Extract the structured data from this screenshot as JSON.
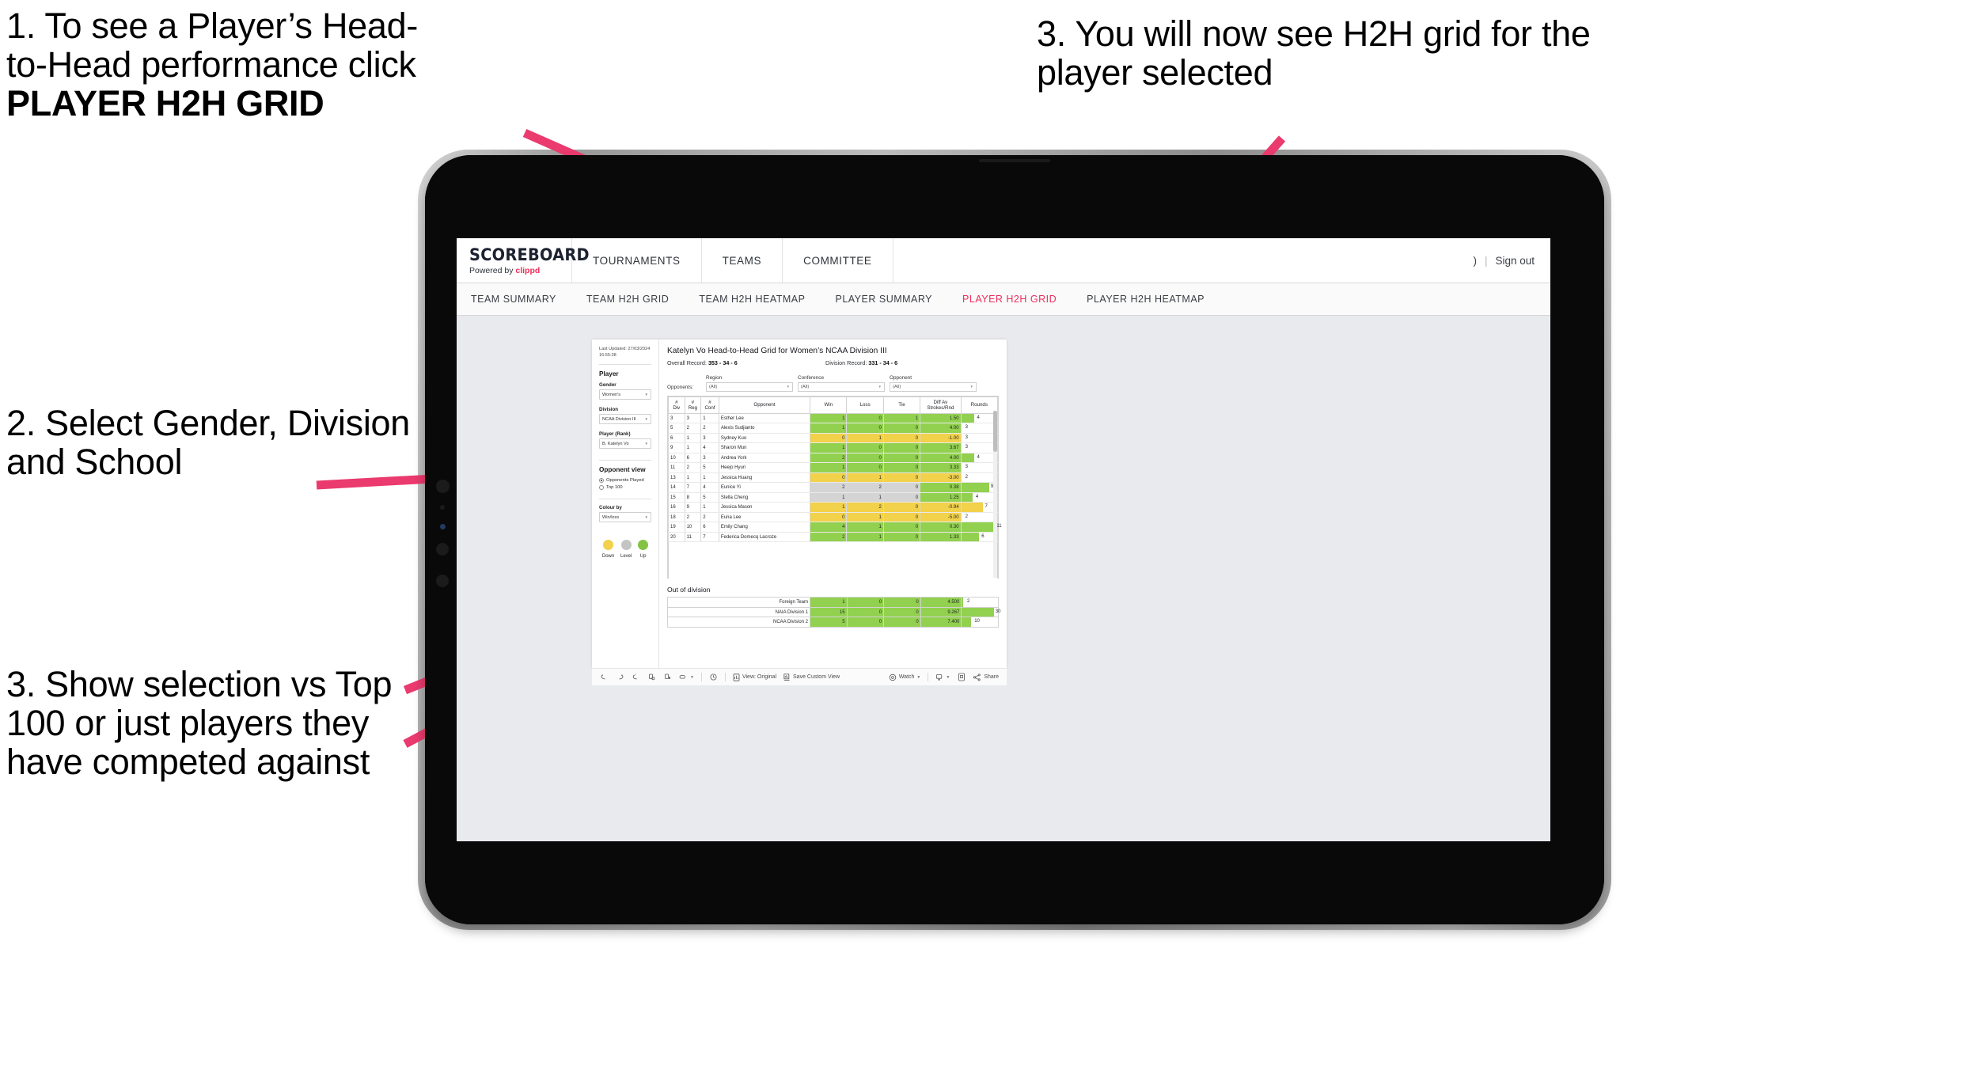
{
  "annotations": {
    "step1_line1": "1. To see a Player’s Head-",
    "step1_line2": "to-Head performance click ",
    "step1_bold": "PLAYER H2H GRID",
    "step2": "2. Select Gender, Division and School",
    "step3_left": "3. Show selection vs Top 100 or just players they have competed against",
    "step3_right": "3. You will now see H2H grid for the player selected",
    "arrow_color": "#ea3a6e"
  },
  "app": {
    "brand_name": "SCOREBOARD",
    "brand_sub_prefix": "Powered by ",
    "brand_sub_accent": "clippd",
    "accent_color": "#ed2d5a",
    "top_nav": [
      {
        "label": "TOURNAMENTS"
      },
      {
        "label": "TEAMS"
      },
      {
        "label": "COMMITTEE"
      }
    ],
    "top_right": {
      "user_glyph": ")",
      "separator": "|",
      "sign_out": "Sign out"
    },
    "sub_nav": [
      {
        "label": "TEAM SUMMARY",
        "active": false
      },
      {
        "label": "TEAM H2H GRID",
        "active": false
      },
      {
        "label": "TEAM H2H HEATMAP",
        "active": false
      },
      {
        "label": "PLAYER SUMMARY",
        "active": false
      },
      {
        "label": "PLAYER H2H GRID",
        "active": true
      },
      {
        "label": "PLAYER H2H HEATMAP",
        "active": false
      }
    ]
  },
  "viz": {
    "sidebar": {
      "last_updated_line1": "Last Updated: 27/03/2024",
      "last_updated_line2": "16:55:38",
      "player_heading": "Player",
      "gender_label": "Gender",
      "gender_value": "Women's",
      "division_label": "Division",
      "division_value": "NCAA Division III",
      "player_rank_label": "Player (Rank)",
      "player_rank_value": "B. Katelyn Vo",
      "opponent_view_heading": "Opponent view",
      "opponent_view_options": [
        {
          "label": "Opponents Played",
          "selected": true
        },
        {
          "label": "Top 100",
          "selected": false
        }
      ],
      "colour_by_label": "Colour by",
      "colour_by_value": "Win/loss",
      "legend": [
        {
          "label": "Down",
          "color": "#f2d14b"
        },
        {
          "label": "Level",
          "color": "#c4c4c4"
        },
        {
          "label": "Up",
          "color": "#82c346"
        }
      ]
    },
    "title": "Katelyn Vo Head-to-Head Grid for Women’s NCAA Division III",
    "overall_record_label": "Overall Record:",
    "overall_record_value": "353 -  34 - 6",
    "division_record_label": "Division Record:",
    "division_record_value": "331 -  34 - 6",
    "opponents_label": "Opponents:",
    "filters": [
      {
        "caption": "Region",
        "value": "(All)"
      },
      {
        "caption": "Conference",
        "value": "(All)"
      },
      {
        "caption": "Opponent",
        "value": "(All)"
      }
    ],
    "columns": [
      {
        "line1": "#",
        "line2": "Div"
      },
      {
        "line1": "#",
        "line2": "Reg"
      },
      {
        "line1": "#",
        "line2": "Conf"
      },
      {
        "line1": "Opponent",
        "line2": ""
      },
      {
        "line1": "Win",
        "line2": ""
      },
      {
        "line1": "Loss",
        "line2": ""
      },
      {
        "line1": "Tie",
        "line2": ""
      },
      {
        "line1": "Diff Av",
        "line2": "Strokes/Rnd"
      },
      {
        "line1": "Rounds",
        "line2": ""
      }
    ],
    "out_of_division_title": "Out of division"
  },
  "chart_data": {
    "type": "table",
    "title": "Katelyn Vo Head-to-Head Grid for Women’s NCAA Division III",
    "columns": [
      "# Div",
      "# Reg",
      "# Conf",
      "Opponent",
      "Win",
      "Loss",
      "Tie",
      "Diff Av Strokes/Rnd",
      "Rounds"
    ],
    "rows": [
      {
        "div": "3",
        "reg": "3",
        "conf": "1",
        "opponent": "Esther Lee",
        "win": "1",
        "loss": "0",
        "tie": "1",
        "diff": "1.50",
        "rounds": "4",
        "state": "up",
        "bar_pct": 36
      },
      {
        "div": "5",
        "reg": "2",
        "conf": "2",
        "opponent": "Alexis Sudjianto",
        "win": "1",
        "loss": "0",
        "tie": "0",
        "diff": "4.00",
        "rounds": "3",
        "state": "up",
        "bar_pct": 0
      },
      {
        "div": "6",
        "reg": "1",
        "conf": "3",
        "opponent": "Sydney Kuo",
        "win": "0",
        "loss": "1",
        "tie": "0",
        "diff": "-1.00",
        "rounds": "3",
        "state": "down",
        "bar_pct": 0
      },
      {
        "div": "9",
        "reg": "1",
        "conf": "4",
        "opponent": "Sharon Mun",
        "win": "1",
        "loss": "0",
        "tie": "0",
        "diff": "3.67",
        "rounds": "3",
        "state": "up",
        "bar_pct": 0
      },
      {
        "div": "10",
        "reg": "6",
        "conf": "3",
        "opponent": "Andrea York",
        "win": "2",
        "loss": "0",
        "tie": "0",
        "diff": "4.00",
        "rounds": "4",
        "state": "up",
        "bar_pct": 36
      },
      {
        "div": "11",
        "reg": "2",
        "conf": "5",
        "opponent": "Heejo Hyun",
        "win": "1",
        "loss": "0",
        "tie": "0",
        "diff": "3.33",
        "rounds": "3",
        "state": "up",
        "bar_pct": 0
      },
      {
        "div": "13",
        "reg": "1",
        "conf": "1",
        "opponent": "Jessica Huang",
        "win": "0",
        "loss": "1",
        "tie": "0",
        "diff": "-3.00",
        "rounds": "2",
        "state": "down",
        "bar_pct": 0
      },
      {
        "div": "14",
        "reg": "7",
        "conf": "4",
        "opponent": "Eunice Yi",
        "win": "2",
        "loss": "2",
        "tie": "0",
        "diff": "0.38",
        "rounds": "9",
        "state": "level",
        "bar_pct": 78,
        "diff_state": "up"
      },
      {
        "div": "15",
        "reg": "8",
        "conf": "5",
        "opponent": "Stella Cheng",
        "win": "1",
        "loss": "1",
        "tie": "0",
        "diff": "1.25",
        "rounds": "4",
        "state": "level",
        "bar_pct": 32,
        "diff_state": "up"
      },
      {
        "div": "16",
        "reg": "9",
        "conf": "1",
        "opponent": "Jessica Mason",
        "win": "1",
        "loss": "2",
        "tie": "0",
        "diff": "-0.94",
        "rounds": "7",
        "state": "down",
        "bar_pct": 60
      },
      {
        "div": "18",
        "reg": "2",
        "conf": "2",
        "opponent": "Euna Lee",
        "win": "0",
        "loss": "1",
        "tie": "0",
        "diff": "-5.00",
        "rounds": "2",
        "state": "down",
        "bar_pct": 0
      },
      {
        "div": "19",
        "reg": "10",
        "conf": "6",
        "opponent": "Emily Chang",
        "win": "4",
        "loss": "1",
        "tie": "0",
        "diff": "0.30",
        "rounds": "11",
        "state": "up",
        "bar_pct": 96
      },
      {
        "div": "20",
        "reg": "11",
        "conf": "7",
        "opponent": "Federica Domecq Lacroze",
        "win": "2",
        "loss": "1",
        "tie": "0",
        "diff": "1.33",
        "rounds": "6",
        "state": "up",
        "bar_pct": 50
      }
    ],
    "out_of_division": [
      {
        "name": "Foreign Team",
        "win": "1",
        "loss": "0",
        "tie": "0",
        "diff": "4.500",
        "rounds": "2",
        "state": "up",
        "bar_pct": 4
      },
      {
        "name": "NAIA Division 1",
        "win": "15",
        "loss": "0",
        "tie": "0",
        "diff": "9.267",
        "rounds": "30",
        "state": "up",
        "bar_pct": 90
      },
      {
        "name": "NCAA Division 2",
        "win": "5",
        "loss": "0",
        "tie": "0",
        "diff": "7.400",
        "rounds": "10",
        "state": "up",
        "bar_pct": 26
      }
    ],
    "legend": [
      {
        "label": "Down",
        "color": "#f2d14b"
      },
      {
        "label": "Level",
        "color": "#c4c4c4"
      },
      {
        "label": "Up",
        "color": "#82c346"
      }
    ]
  },
  "toolbar": {
    "icons": [
      {
        "name": "undo-icon"
      },
      {
        "name": "redo-icon"
      },
      {
        "name": "revert-icon"
      },
      {
        "name": "refresh-data-icon"
      },
      {
        "name": "pause-updates-icon"
      },
      {
        "name": "view-toggle-icon"
      }
    ],
    "alert_icon": "alert-icon",
    "view_original": "View: Original",
    "save_custom_view": "Save Custom View",
    "watch": "Watch",
    "download": "download-icon",
    "fullscreen": "fullscreen-icon",
    "share": "Share"
  }
}
